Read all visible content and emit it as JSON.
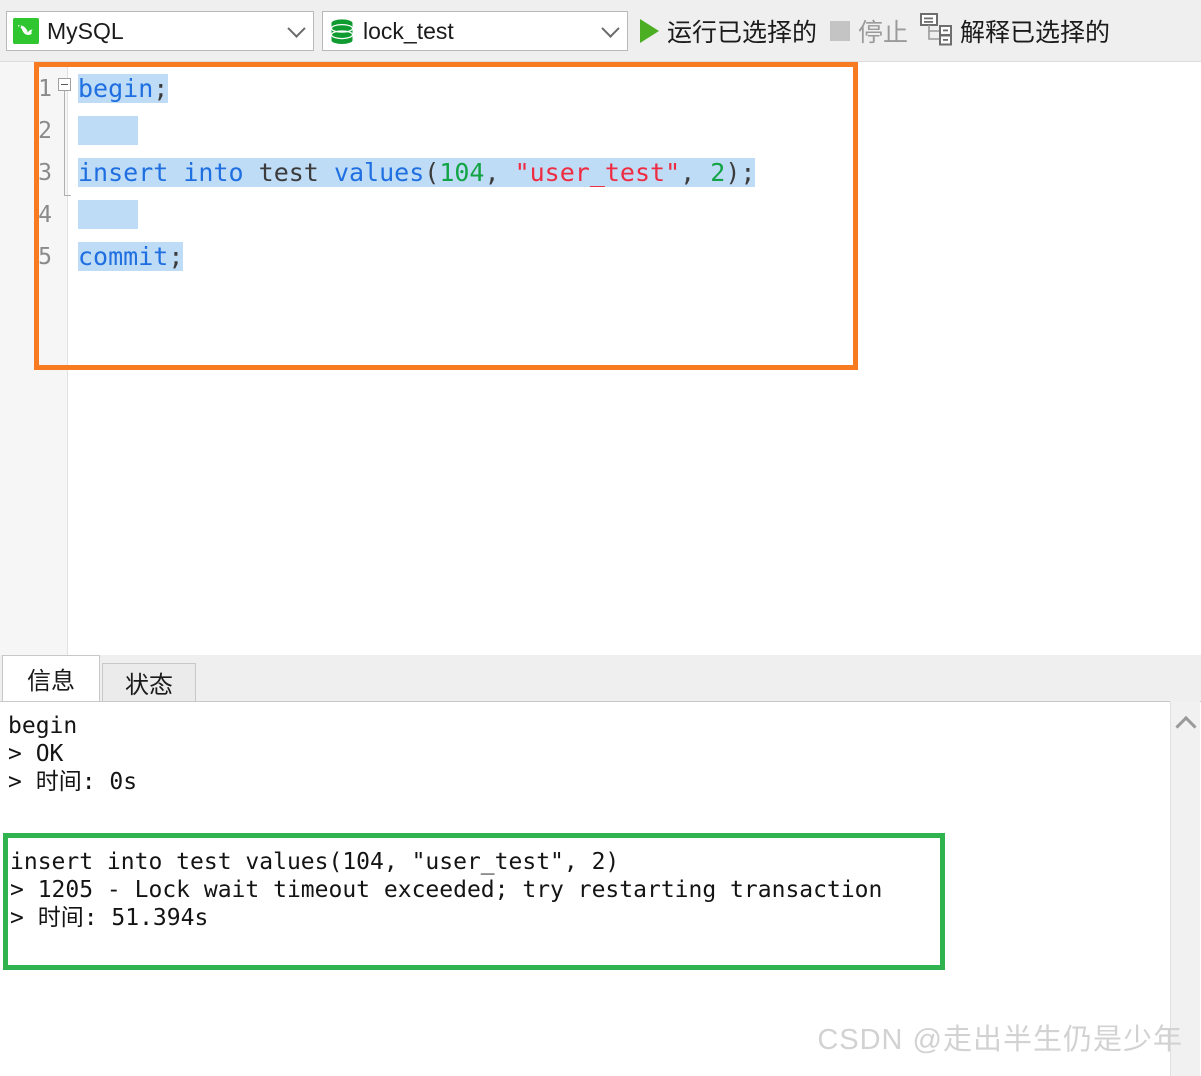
{
  "toolbar": {
    "connection": {
      "label": "MySQL",
      "icon": "mysql-dolphin-icon"
    },
    "database": {
      "label": "lock_test",
      "icon": "database-cylinder-icon"
    },
    "run_selected": {
      "label": "运行已选择的",
      "icon": "play-icon",
      "enabled": true
    },
    "stop": {
      "label": "停止",
      "icon": "stop-square-icon",
      "enabled": false
    },
    "explain_selected": {
      "label": "解释已选择的",
      "icon": "explain-plan-icon",
      "enabled": true
    }
  },
  "editor": {
    "line_numbers": [
      "1",
      "2",
      "3",
      "4",
      "5"
    ],
    "lines": [
      {
        "n": "1",
        "tokens": [
          {
            "t": "begin",
            "c": "kw"
          },
          {
            "t": ";",
            "c": "pun"
          }
        ]
      },
      {
        "n": "2",
        "tokens": []
      },
      {
        "n": "3",
        "tokens": [
          {
            "t": "insert",
            "c": "kw"
          },
          {
            "t": " ",
            "c": "pun"
          },
          {
            "t": "into",
            "c": "kw"
          },
          {
            "t": " ",
            "c": "pun"
          },
          {
            "t": "test",
            "c": "id"
          },
          {
            "t": " ",
            "c": "pun"
          },
          {
            "t": "values",
            "c": "kw"
          },
          {
            "t": "(",
            "c": "pun"
          },
          {
            "t": "104",
            "c": "num"
          },
          {
            "t": ", ",
            "c": "pun"
          },
          {
            "t": "\"user_test\"",
            "c": "str"
          },
          {
            "t": ", ",
            "c": "pun"
          },
          {
            "t": "2",
            "c": "num"
          },
          {
            "t": ");",
            "c": "pun"
          }
        ]
      },
      {
        "n": "4",
        "tokens": []
      },
      {
        "n": "5",
        "tokens": [
          {
            "t": "commit",
            "c": "kw"
          },
          {
            "t": ";",
            "c": "pun"
          }
        ]
      }
    ],
    "plain_text": "begin;\n\ninsert into test values(104, \"user_test\", 2);\n\ncommit;",
    "selection_active": true
  },
  "panel": {
    "tabs": [
      {
        "label": "信息",
        "active": true
      },
      {
        "label": "状态",
        "active": false
      }
    ],
    "log_block_1": "begin\n> OK\n> 时间: 0s",
    "log_block_2": "insert into test values(104, \"user_test\", 2)\n> 1205 - Lock wait timeout exceeded; try restarting transaction\n> 时间: 51.394s",
    "log_entries": [
      {
        "statement": "begin",
        "result": "OK",
        "time": "0s"
      },
      {
        "statement": "insert into test values(104, \"user_test\", 2)",
        "result": "1205 - Lock wait timeout exceeded; try restarting transaction",
        "time": "51.394s"
      }
    ]
  },
  "annotations": {
    "orange_box": {
      "color": "#f97b21",
      "target": "sql-editor-statements"
    },
    "green_box": {
      "color": "#2fb34e",
      "target": "lock-timeout-error-log"
    }
  },
  "watermark": {
    "text": "CSDN @走出半生仍是少年"
  }
}
